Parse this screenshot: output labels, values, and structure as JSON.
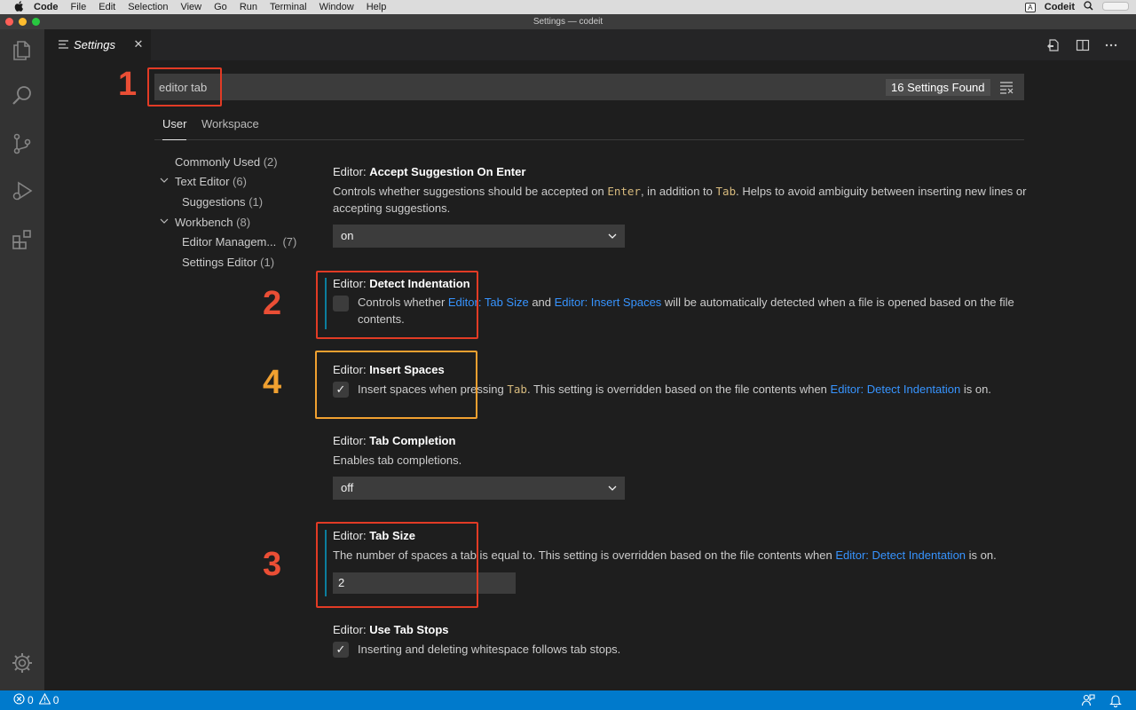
{
  "menubar": {
    "app": "Code",
    "items": [
      "File",
      "Edit",
      "Selection",
      "View",
      "Go",
      "Run",
      "Terminal",
      "Window",
      "Help"
    ],
    "input_source": "A",
    "user": "Codeit"
  },
  "window": {
    "title": "Settings — codeit"
  },
  "tab": {
    "label": "Settings",
    "close": "✕"
  },
  "search": {
    "value": "editor tab",
    "results": "16 Settings Found"
  },
  "scopes": {
    "user": "User",
    "workspace": "Workspace"
  },
  "toc": {
    "commonly_used": {
      "label": "Commonly Used",
      "count": "(2)"
    },
    "text_editor": {
      "label": "Text Editor",
      "count": "(6)"
    },
    "suggestions": {
      "label": "Suggestions",
      "count": "(1)"
    },
    "workbench": {
      "label": "Workbench",
      "count": "(8)"
    },
    "editor_management": {
      "label": "Editor Managem...",
      "count": "(7)"
    },
    "settings_editor": {
      "label": "Settings Editor",
      "count": "(1)"
    }
  },
  "settings": {
    "accept_suggestion": {
      "category": "Editor: ",
      "name": "Accept Suggestion On Enter",
      "desc_a": "Controls whether suggestions should be accepted on ",
      "code_a": "Enter",
      "desc_b": ", in addition to ",
      "code_b": "Tab",
      "desc_c": ". Helps to avoid ambiguity between inserting new lines or accepting suggestions.",
      "value": "on"
    },
    "detect_indentation": {
      "category": "Editor: ",
      "name": "Detect Indentation",
      "desc_a": "Controls whether ",
      "link_a": "Editor: Tab Size",
      "desc_b": " and ",
      "link_b": "Editor: Insert Spaces",
      "desc_c": " will be automatically detected when a file is opened based on the file contents.",
      "checked": false
    },
    "insert_spaces": {
      "category": "Editor: ",
      "name": "Insert Spaces",
      "desc_a": "Insert spaces when pressing ",
      "code_a": "Tab",
      "desc_b": ". This setting is overridden based on the file contents when ",
      "link_a": "Editor: Detect Indentation",
      "desc_c": " is on.",
      "check": "✓",
      "checked": true
    },
    "tab_completion": {
      "category": "Editor: ",
      "name": "Tab Completion",
      "desc": "Enables tab completions.",
      "value": "off"
    },
    "tab_size": {
      "category": "Editor: ",
      "name": "Tab Size",
      "desc_a": "The number of spaces a tab is equal to. This setting is overridden based on the file contents when ",
      "link_a": "Editor: Detect Indentation",
      "desc_b": " is on.",
      "value": "2"
    },
    "use_tab_stops": {
      "category": "Editor: ",
      "name": "Use Tab Stops",
      "desc": "Inserting and deleting whitespace follows tab stops.",
      "check": "✓",
      "checked": true
    }
  },
  "annotations": {
    "n1": "1",
    "n2": "2",
    "n3": "3",
    "n4": "4"
  },
  "status": {
    "errors": "0",
    "warnings": "0"
  },
  "colors": {
    "accent": "#007acc",
    "annotation_red": "#e23b25",
    "annotation_orange": "#f0a030",
    "link": "#3794ff"
  },
  "icons": [
    "apple-icon",
    "search-icon",
    "explorer-icon",
    "source-control-icon",
    "run-debug-icon",
    "extensions-icon",
    "gear-icon",
    "open-json-icon",
    "split-editor-icon",
    "more-actions-icon",
    "clear-filter-icon",
    "chevron-down-icon",
    "error-icon",
    "warning-icon",
    "feedback-icon",
    "bell-icon"
  ]
}
